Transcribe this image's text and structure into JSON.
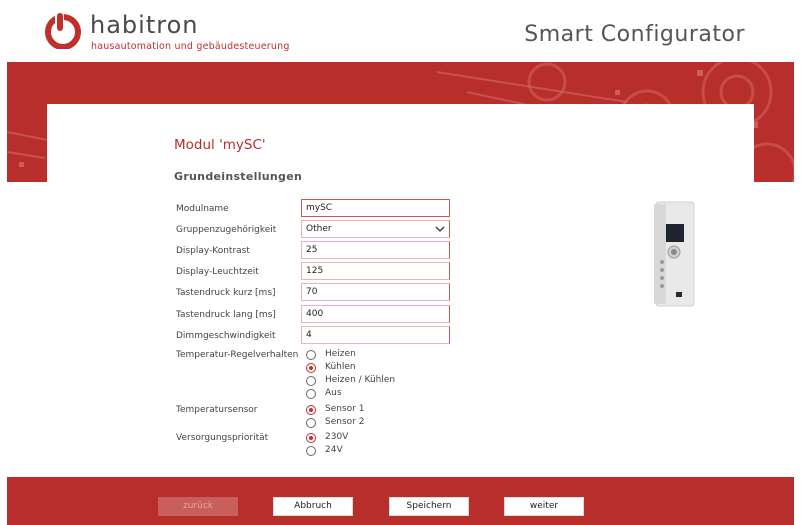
{
  "brand": {
    "name": "habitron",
    "tagline": "hausautomation und gebäudesteuerung",
    "app_title": "Smart Configurator",
    "accent_color": "#b72e2b"
  },
  "module": {
    "title": "Modul 'mySC'",
    "section": "Grundeinstellungen"
  },
  "fields": [
    {
      "label": "Modulname",
      "value": "mySC"
    },
    {
      "label": "Gruppenzugehörigkeit",
      "value": "Other"
    },
    {
      "label": "Display-Kontrast",
      "value": "25"
    },
    {
      "label": "Display-Leuchtzeit",
      "value": "125"
    },
    {
      "label": "Tastendruck kurz [ms]",
      "value": "70"
    },
    {
      "label": "Tastendruck lang [ms]",
      "value": "400"
    },
    {
      "label": "Dimmgeschwindigkeit",
      "value": "4"
    }
  ],
  "radio_groups": [
    {
      "label": "Temperatur-Regelverhalten",
      "options": [
        "Heizen",
        "Kühlen",
        "Heizen / Kühlen",
        "Aus"
      ],
      "selected": 1
    },
    {
      "label": "Temperatursensor",
      "options": [
        "Sensor 1",
        "Sensor 2"
      ],
      "selected": 0
    },
    {
      "label": "Versorgungspriorität",
      "options": [
        "230V",
        "24V"
      ],
      "selected": 0
    }
  ],
  "buttons": {
    "back": "zurück",
    "cancel": "Abbruch",
    "save": "Speichern",
    "next": "weiter"
  }
}
